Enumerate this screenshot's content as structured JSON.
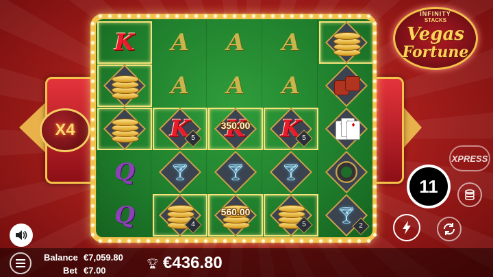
{
  "multiplier": {
    "label": "X4"
  },
  "logo": {
    "line1": "INFINITY",
    "line2": "STACKS",
    "line3": "Vegas",
    "line4": "Fortune"
  },
  "grid": {
    "reels": [
      [
        {
          "sym": "K",
          "val": ""
        },
        {
          "sym": "coins",
          "val": ""
        },
        {
          "sym": "coins",
          "val": ""
        },
        {
          "sym": "Q",
          "val": ""
        },
        {
          "sym": "Q",
          "val": ""
        }
      ],
      [
        {
          "sym": "A",
          "val": ""
        },
        {
          "sym": "A",
          "val": ""
        },
        {
          "sym": "K-stack",
          "val": "5"
        },
        {
          "sym": "martini",
          "val": ""
        },
        {
          "sym": "coins-stack",
          "val": "4"
        }
      ],
      [
        {
          "sym": "A",
          "val": ""
        },
        {
          "sym": "A",
          "val": ""
        },
        {
          "sym": "K-cash",
          "val": "350.00"
        },
        {
          "sym": "martini",
          "val": ""
        },
        {
          "sym": "coins-cash",
          "val": "560.00"
        }
      ],
      [
        {
          "sym": "A",
          "val": ""
        },
        {
          "sym": "A",
          "val": ""
        },
        {
          "sym": "K-stack",
          "val": "5"
        },
        {
          "sym": "martini",
          "val": ""
        },
        {
          "sym": "coins-stack",
          "val": "5"
        }
      ],
      [
        {
          "sym": "coins",
          "val": ""
        },
        {
          "sym": "dice",
          "val": ""
        },
        {
          "sym": "cards",
          "val": ""
        },
        {
          "sym": "roulette",
          "val": ""
        },
        {
          "sym": "martini-stack",
          "val": "2"
        }
      ]
    ],
    "highlighted": [
      "0-0",
      "0-1",
      "0-2",
      "1-2",
      "2-2",
      "3-2",
      "1-4",
      "2-4",
      "3-4",
      "4-0"
    ]
  },
  "controls": {
    "xpress_label": "XPRESS",
    "spin_count": "11"
  },
  "footer": {
    "balance_label": "Balance",
    "balance_value": "€7,059.80",
    "bet_label": "Bet",
    "bet_value": "€7.00",
    "win_value": "€436.80"
  },
  "colors": {
    "felt": "#1f7e2c",
    "frame_gold": "#f2c24b",
    "background_red": "#a81f1c"
  }
}
